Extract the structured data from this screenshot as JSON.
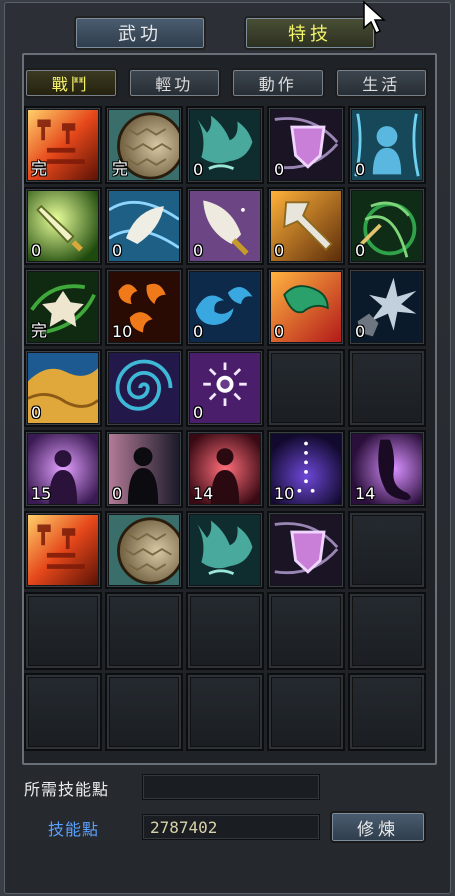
{
  "top_tabs": [
    {
      "label": "武功",
      "active": false
    },
    {
      "label": "特技",
      "active": true
    }
  ],
  "sub_tabs": [
    {
      "label": "戰鬥",
      "active": true
    },
    {
      "label": "輕功",
      "active": false
    },
    {
      "label": "動作",
      "active": false
    },
    {
      "label": "生活",
      "active": false
    }
  ],
  "skills": [
    {
      "icon": "fire-ladder-icon",
      "level": "完"
    },
    {
      "icon": "turtle-shell-icon",
      "level": "完"
    },
    {
      "icon": "spirit-claw-icon",
      "level": "0"
    },
    {
      "icon": "violet-shield-icon",
      "level": "0"
    },
    {
      "icon": "ghost-spirit-icon",
      "level": "0"
    },
    {
      "icon": "green-blade-icon",
      "level": "0"
    },
    {
      "icon": "white-feather-icon",
      "level": "0"
    },
    {
      "icon": "purple-broadsword-icon",
      "level": "0"
    },
    {
      "icon": "golden-axe-icon",
      "level": "0"
    },
    {
      "icon": "green-bow-icon",
      "level": "0"
    },
    {
      "icon": "spinning-star-icon",
      "level": "完"
    },
    {
      "icon": "flame-wave-icon",
      "level": "10"
    },
    {
      "icon": "water-wave-icon",
      "level": "0"
    },
    {
      "icon": "jade-bracer-icon",
      "level": "0"
    },
    {
      "icon": "shattered-rock-icon",
      "level": "0"
    },
    {
      "icon": "golden-dune-icon",
      "level": "0"
    },
    {
      "icon": "vortex-icon",
      "level": ""
    },
    {
      "icon": "wheel-burst-icon",
      "level": "0"
    },
    {
      "icon": "",
      "level": ""
    },
    {
      "icon": "",
      "level": ""
    },
    {
      "icon": "violet-aura-figure-icon",
      "level": "15"
    },
    {
      "icon": "shadow-figure-icon",
      "level": "0"
    },
    {
      "icon": "red-aura-figure-icon",
      "level": "14"
    },
    {
      "icon": "meridian-figure-icon",
      "level": "10"
    },
    {
      "icon": "purple-foot-icon",
      "level": "14"
    },
    {
      "icon": "fire-ladder-icon",
      "level": ""
    },
    {
      "icon": "turtle-shell-icon",
      "level": ""
    },
    {
      "icon": "spirit-claw-icon",
      "level": ""
    },
    {
      "icon": "violet-shield-icon",
      "level": ""
    },
    {
      "icon": "",
      "level": ""
    },
    {
      "icon": "",
      "level": ""
    },
    {
      "icon": "",
      "level": ""
    },
    {
      "icon": "",
      "level": ""
    },
    {
      "icon": "",
      "level": ""
    },
    {
      "icon": "",
      "level": ""
    },
    {
      "icon": "",
      "level": ""
    },
    {
      "icon": "",
      "level": ""
    },
    {
      "icon": "",
      "level": ""
    },
    {
      "icon": "",
      "level": ""
    },
    {
      "icon": "",
      "level": ""
    }
  ],
  "footer": {
    "required_points_label": "所需技能點",
    "required_points_value": "",
    "skill_points_label": "技能點",
    "skill_points_value": "2787402",
    "train_label": "修煉"
  }
}
